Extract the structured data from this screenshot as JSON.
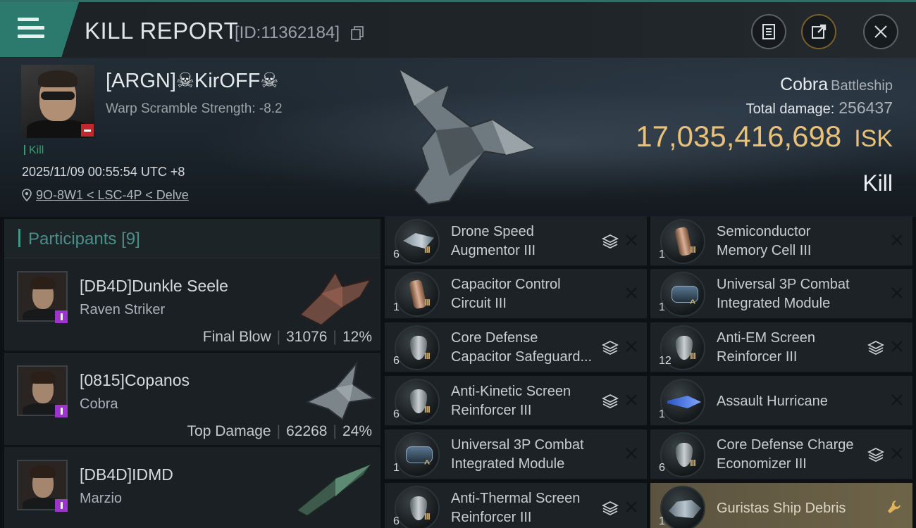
{
  "header": {
    "title": "KILL REPORT",
    "id_text": "[ID:11362184]"
  },
  "victim": {
    "name": "[ARGN]☠KirOFF☠",
    "warp_scramble": "Warp Scramble Strength: -8.2",
    "kill_tag": "Kill",
    "datetime": "2025/11/09 00:55:54 UTC +8",
    "location": "9O-8W1 < LSC-4P < Delve",
    "ship_name": "Cobra",
    "ship_class": "Battleship",
    "total_damage_label": "Total damage:",
    "total_damage_value": "256437",
    "isk_value": "17,035,416,698",
    "isk_unit": "ISK",
    "result": "Kill"
  },
  "participants": {
    "header_label": "Participants",
    "count": "[9]",
    "rows": [
      {
        "name": "[DB4D]Dunkle Seele",
        "ship": "Raven Striker",
        "tag": "Final Blow",
        "damage": "31076",
        "percent": "12%"
      },
      {
        "name": "[0815]Copanos",
        "ship": "Cobra",
        "tag": "Top Damage",
        "damage": "62268",
        "percent": "24%"
      },
      {
        "name": "[DB4D]IDMD",
        "ship": "Marzio",
        "tag": "",
        "damage": "",
        "percent": ""
      }
    ]
  },
  "items": [
    {
      "qty": "6",
      "line1": "Drone Speed",
      "line2": "Augmentor III",
      "icon": "drone-icon",
      "tier": "III",
      "stackable": true
    },
    {
      "qty": "1",
      "line1": "Semiconductor",
      "line2": "Memory Cell III",
      "icon": "cylinder-icon",
      "tier": "III",
      "stackable": false
    },
    {
      "qty": "1",
      "line1": "Capacitor Control",
      "line2": "Circuit III",
      "icon": "cylinder-icon",
      "tier": "III",
      "stackable": false
    },
    {
      "qty": "1",
      "line1": "Universal 3P Combat",
      "line2": "Integrated Module",
      "icon": "module-icon",
      "tier": "^",
      "stackable": false
    },
    {
      "qty": "6",
      "line1": "Core Defense",
      "line2": "Capacitor Safeguard...",
      "icon": "shield-icon",
      "tier": "III",
      "stackable": true
    },
    {
      "qty": "12",
      "line1": "Anti-EM Screen",
      "line2": "Reinforcer III",
      "icon": "shield-icon",
      "tier": "III",
      "stackable": true
    },
    {
      "qty": "6",
      "line1": "Anti-Kinetic Screen",
      "line2": "Reinforcer III",
      "icon": "shield-icon",
      "tier": "III",
      "stackable": true
    },
    {
      "qty": "1",
      "line1": "Assault Hurricane",
      "line2": "",
      "icon": "frigate-icon",
      "tier": "",
      "stackable": false
    },
    {
      "qty": "1",
      "line1": "Universal 3P Combat",
      "line2": "Integrated Module",
      "icon": "module-icon",
      "tier": "^",
      "stackable": false
    },
    {
      "qty": "6",
      "line1": "Core Defense Charge",
      "line2": "Economizer III",
      "icon": "shield-icon",
      "tier": "III",
      "stackable": true
    },
    {
      "qty": "6",
      "line1": "Anti-Thermal Screen",
      "line2": "Reinforcer III",
      "icon": "shield-icon",
      "tier": "III",
      "stackable": true
    },
    {
      "qty": "1",
      "line1": "Guristas Ship Debris",
      "line2": "",
      "icon": "debris-icon",
      "tier": "",
      "stackable": false,
      "highlight": true
    }
  ],
  "colors": {
    "accent": "#2c7a6d",
    "isk": "#e9c277",
    "kill_tag": "#3b9a6d",
    "corp_badge": "#9a36c9",
    "danger": "#c0282d"
  }
}
